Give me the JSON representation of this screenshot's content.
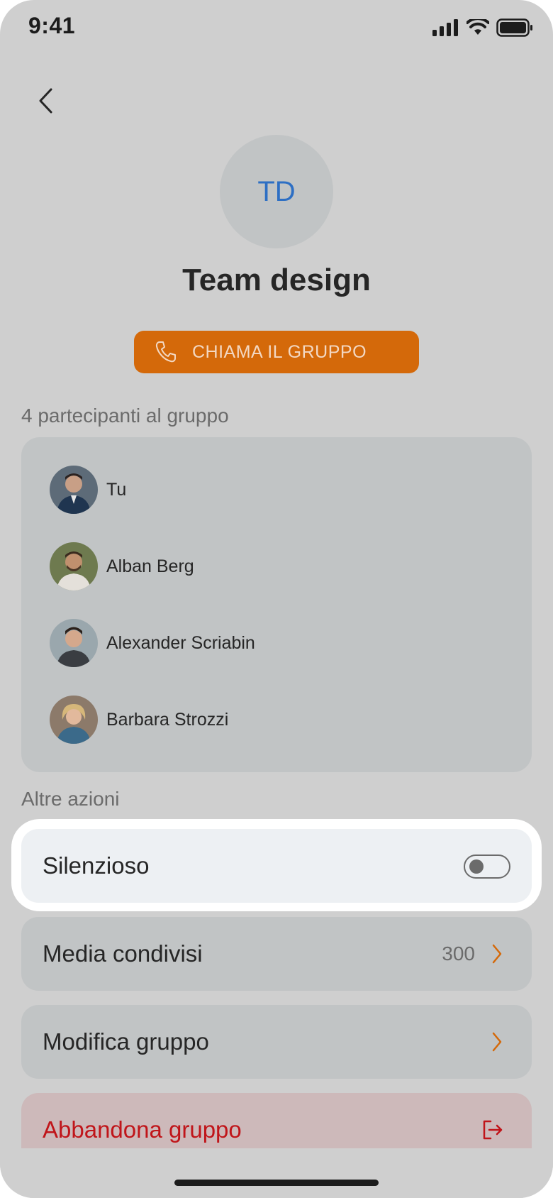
{
  "status_bar": {
    "time": "9:41"
  },
  "header": {
    "avatar_initials": "TD",
    "group_name": "Team design"
  },
  "call_button": {
    "label": "CHIAMA IL GRUPPO"
  },
  "participants": {
    "section_label": "4 partecipanti al gruppo",
    "items": [
      {
        "name": "Tu"
      },
      {
        "name": "Alban Berg"
      },
      {
        "name": "Alexander Scriabin"
      },
      {
        "name": "Barbara Strozzi"
      }
    ]
  },
  "actions": {
    "section_label": "Altre azioni",
    "silent": {
      "label": "Silenzioso",
      "enabled": false
    },
    "shared_media": {
      "label": "Media condivisi",
      "count": "300"
    },
    "edit_group": {
      "label": "Modifica gruppo"
    },
    "leave_group": {
      "label": "Abbandona gruppo"
    }
  },
  "colors": {
    "accent": "#d4690a",
    "initials": "#2d6fc4",
    "danger": "#c0151a",
    "background": "#cfcfcf",
    "card": "#c1c4c5"
  }
}
